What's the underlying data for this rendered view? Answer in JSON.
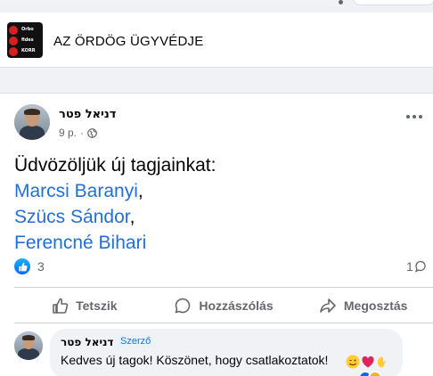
{
  "group": {
    "name": "AZ ÖRDÖG ÜGYVÉDJE",
    "thumb_lines": [
      "Orbo",
      "fides",
      "KORR"
    ]
  },
  "post": {
    "author": "דניאל פטר",
    "time": "9 p.",
    "separator": "·",
    "greeting": "Üdvözöljük új tagjainkat:",
    "tags": [
      "Marcsi Baranyi",
      "Szücs Sándor",
      "Ferencné Bihari"
    ],
    "tag_suffixes": [
      ",",
      ",",
      ""
    ],
    "like_count": "3",
    "comment_count": "1",
    "actions": {
      "like": "Tetszik",
      "comment": "Hozzászólás",
      "share": "Megosztás"
    }
  },
  "comment": {
    "author": "דניאל פטר",
    "badge": "Szerző",
    "text": "Kedves új tagok! Köszönet, hogy csatlakoztatok!"
  },
  "colors": {
    "link": "#216fdb",
    "like_blue": "#0866ff",
    "muted": "#65676b"
  },
  "icons": [
    "more-icon",
    "globe-icon",
    "like-icon",
    "comment-icon",
    "share-icon"
  ]
}
